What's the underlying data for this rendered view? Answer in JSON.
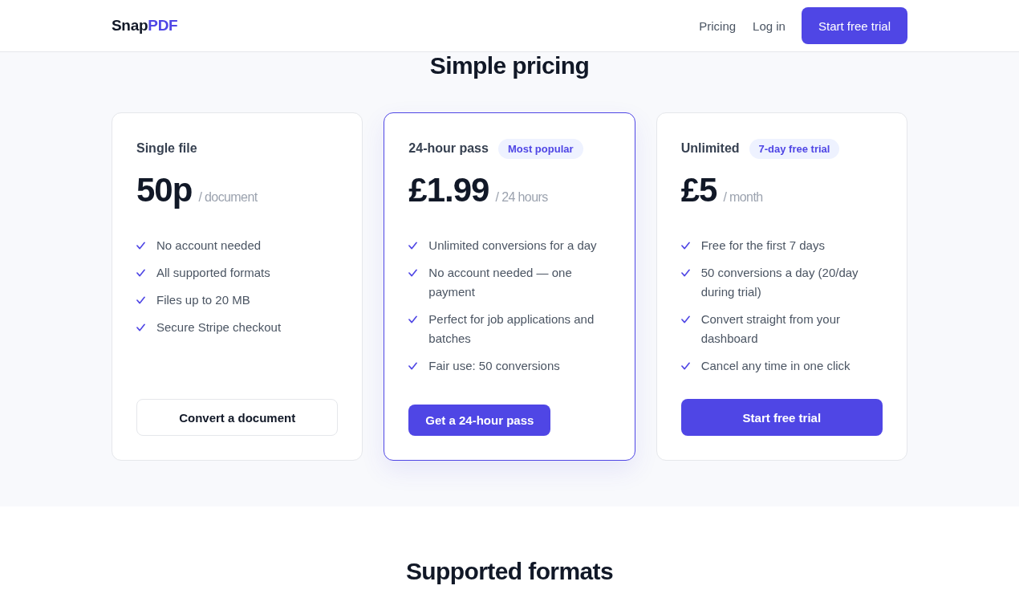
{
  "header": {
    "logo": {
      "name": "Snap",
      "accent": "PDF"
    },
    "nav": [
      "Pricing",
      "Log in"
    ],
    "cta": "Start free trial"
  },
  "pricing": {
    "title": "Simple pricing",
    "plans": [
      {
        "name": "Single file",
        "featured": false,
        "price": "50p",
        "period": "/ document",
        "features": [
          "No account needed",
          "All supported formats",
          "Files up to 20 MB",
          "Secure Stripe checkout"
        ],
        "button": {
          "label": "Convert a document",
          "kind": "outline",
          "full_width": true
        }
      },
      {
        "name": "24-hour pass",
        "badge": "Most popular",
        "featured": true,
        "price": "£1.99",
        "period": "/ 24 hours",
        "features": [
          "Unlimited conversions for a day",
          "No account needed — one payment",
          "Perfect for job applications and batches",
          "Fair use: 50 conversions"
        ],
        "button": {
          "label": "Get a 24-hour pass",
          "kind": "solid",
          "full_width": false
        }
      },
      {
        "name": "Unlimited",
        "badge": "7-day free trial",
        "featured": false,
        "price": "£5",
        "period": "/ month",
        "features": [
          "Free for the first 7 days",
          "50 conversions a day (20/day during trial)",
          "Convert straight from your dashboard",
          "Cancel any time in one click"
        ],
        "button": {
          "label": "Start free trial",
          "kind": "solid",
          "full_width": true
        }
      }
    ]
  },
  "formats": {
    "title": "Supported formats"
  }
}
